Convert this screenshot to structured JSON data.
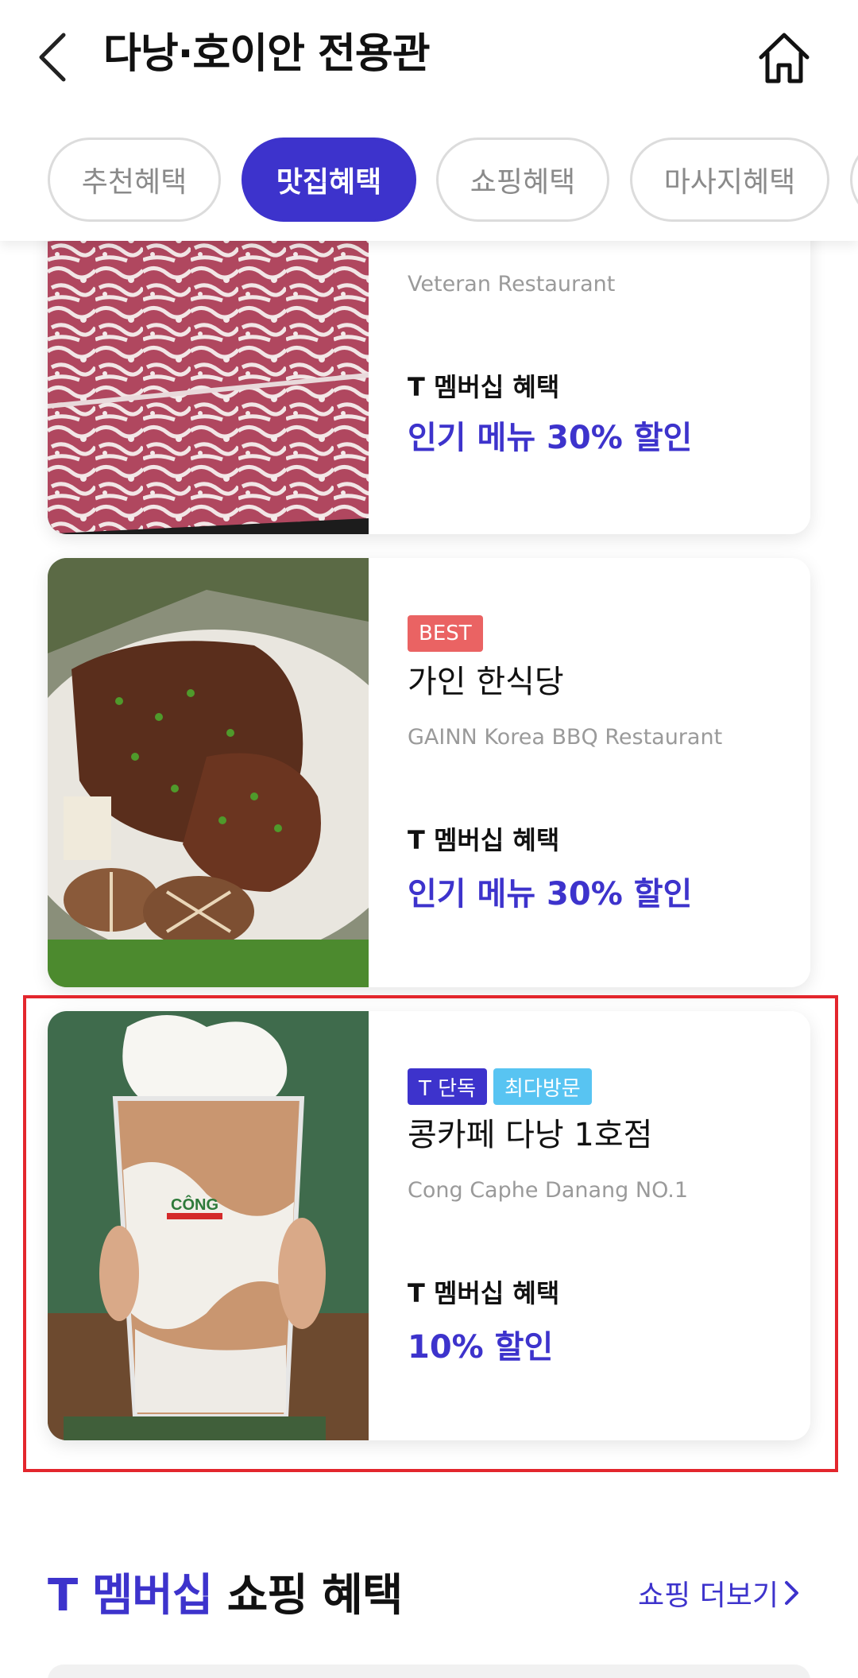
{
  "header": {
    "title": "다낭·호이안 전용관",
    "back_icon": "chevron-left-icon",
    "home_icon": "home-icon"
  },
  "tabs": [
    {
      "label": "추천혜택",
      "active": false
    },
    {
      "label": "맛집혜택",
      "active": true
    },
    {
      "label": "쇼핑혜택",
      "active": false
    },
    {
      "label": "마사지혜택",
      "active": false
    }
  ],
  "cards": [
    {
      "title": "",
      "subtitle": "Veteran Restaurant",
      "benefit_label": "T 멤버십 혜택",
      "benefit_value": "인기 메뉴 30% 할인"
    },
    {
      "badge": "BEST",
      "title": "가인 한식당",
      "subtitle": "GAINN Korea BBQ Restaurant",
      "benefit_label": "T 멤버십 혜택",
      "benefit_value": "인기 메뉴 30% 할인"
    },
    {
      "badges": [
        "T 단독",
        "최다방문"
      ],
      "title": "콩카페 다낭 1호점",
      "subtitle": "Cong Caphe Danang NO.1",
      "benefit_label": "T 멤버십 혜택",
      "benefit_value": "10% 할인",
      "image_text": "CÔNG"
    }
  ],
  "section": {
    "title_accent": "T 멤버십",
    "title_rest": " 쇼핑 혜택",
    "more_label": "쇼핑 더보기",
    "more_icon": "chevron-right-icon"
  },
  "colors": {
    "accent": "#3d33cc",
    "best_badge": "#ea6363",
    "popular_badge": "#58c4f2",
    "highlight_border": "#e3262d"
  }
}
